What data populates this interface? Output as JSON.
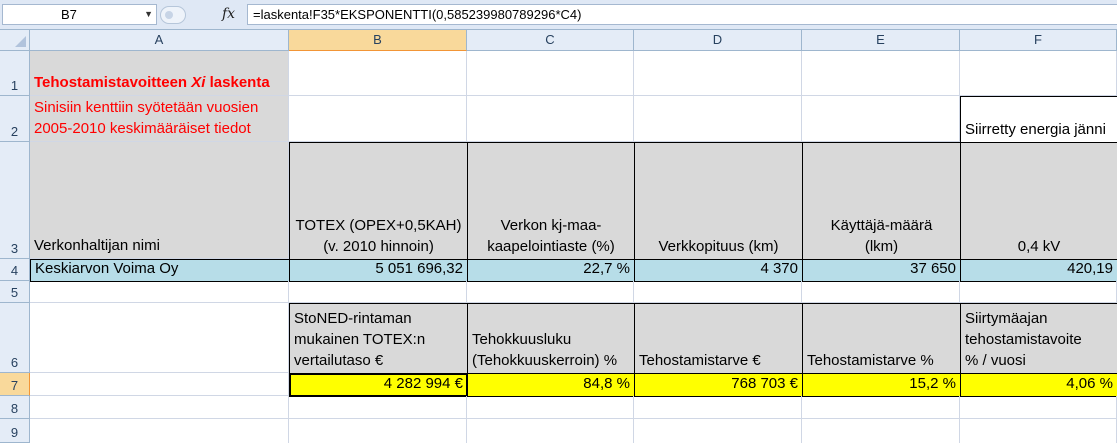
{
  "formula_bar": {
    "name_box": "B7",
    "fx_label": "fx",
    "formula": "=laskenta!F35*EKSPONENTTI(0,585239980789296*C4)"
  },
  "columns": [
    "A",
    "B",
    "C",
    "D",
    "E",
    "F"
  ],
  "rows": [
    "1",
    "2",
    "3",
    "4",
    "5",
    "6",
    "7",
    "8",
    "9"
  ],
  "cells": {
    "A1_bold": "Tehostamistavoitteen ",
    "A1_italic": "Xi",
    "A1_tail": " laskenta",
    "A2_line1": "Sinisiin kenttiin syötetään vuosien",
    "A2_line2": "2005-2010 keskimääräiset tiedot",
    "F2": "Siirretty energia jänni",
    "A3": "Verkonhaltijan nimi",
    "B3_line1": "TOTEX (OPEX+0,5KAH)",
    "B3_line2": "(v. 2010 hinnoin)",
    "C3_line1": "Verkon kj-maa-",
    "C3_line2": "kaapelointiaste (%)",
    "D3": "Verkkopituus (km)",
    "E3_line1": "Käyttäjä-määrä",
    "E3_line2": "(lkm)",
    "F3": "0,4 kV",
    "A4": "Keskiarvon Voima Oy",
    "B4": "5 051 696,32",
    "C4": "22,7 %",
    "D4": "4 370",
    "E4": "37 650",
    "F4": "420,19",
    "B6_line1": "StoNED-rintaman",
    "B6_line2": "mukainen TOTEX:n",
    "B6_line3": "vertailutaso €",
    "C6_line1": "Tehokkuusluku",
    "C6_line2": "(Tehokkuuskerroin) %",
    "D6": "Tehostamistarve €",
    "E6": "Tehostamistarve %",
    "F6_line1": "Siirtymäajan",
    "F6_line2": "tehostamistavoite",
    "F6_line3": "% / vuosi",
    "B7": "4 282 994 €",
    "C7": "84,8 %",
    "D7": "768 703 €",
    "E7": "15,2 %",
    "F7": "4,06 %"
  },
  "colors": {
    "gray": "#d9d9d9",
    "blue": "#b7dde8",
    "yellow": "#ffff00",
    "red": "#ff0000"
  }
}
